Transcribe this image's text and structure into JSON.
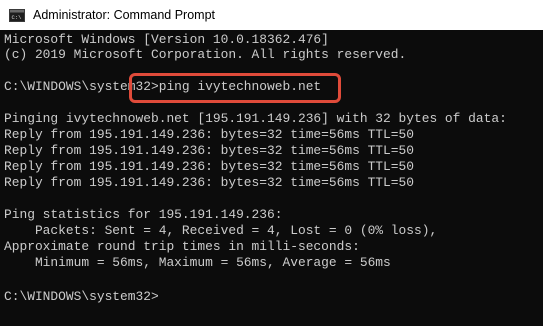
{
  "window": {
    "title": "Administrator: Command Prompt",
    "icon": "cmd-icon"
  },
  "console": {
    "lines": [
      "Microsoft Windows [Version 10.0.18362.476]",
      "(c) 2019 Microsoft Corporation. All rights reserved.",
      "",
      "C:\\WINDOWS\\system32>ping ivytechnoweb.net",
      "",
      "Pinging ivytechnoweb.net [195.191.149.236] with 32 bytes of data:",
      "Reply from 195.191.149.236: bytes=32 time=56ms TTL=50",
      "Reply from 195.191.149.236: bytes=32 time=56ms TTL=50",
      "Reply from 195.191.149.236: bytes=32 time=56ms TTL=50",
      "Reply from 195.191.149.236: bytes=32 time=56ms TTL=50",
      "",
      "Ping statistics for 195.191.149.236:",
      "    Packets: Sent = 4, Received = 4, Lost = 0 (0% loss),",
      "Approximate round trip times in milli-seconds:",
      "    Minimum = 56ms, Maximum = 56ms, Average = 56ms",
      "",
      "C:\\WINDOWS\\system32>"
    ]
  },
  "colors": {
    "console_background": "#0c0c0c",
    "console_text": "#cccccc",
    "highlight_border": "#e04b3a",
    "titlebar_background": "#ffffff"
  }
}
